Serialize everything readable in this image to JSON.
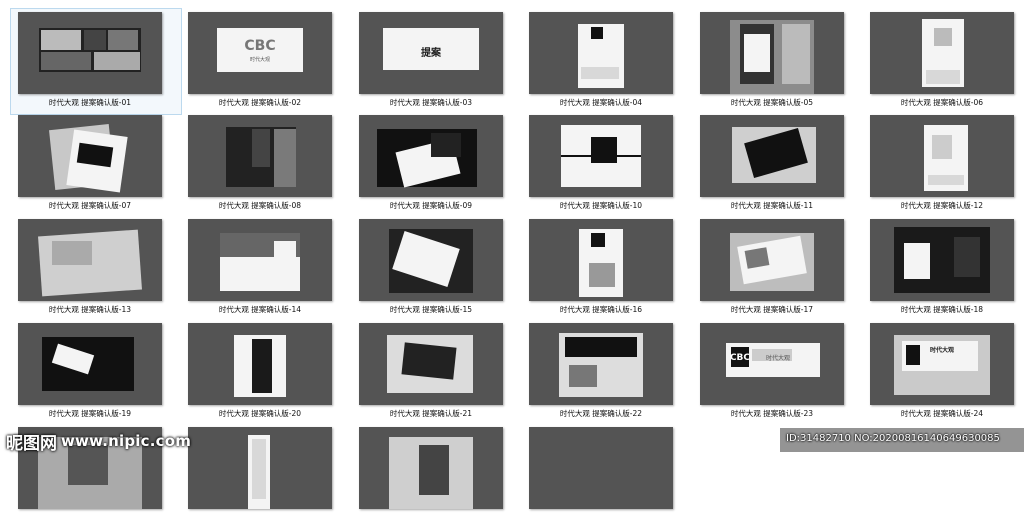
{
  "slides": [
    {
      "caption": "时代大观 提案确认版-01",
      "selected": true
    },
    {
      "caption": "时代大观 提案确认版-02",
      "logo": "CBC",
      "sub": "时代大观"
    },
    {
      "caption": "时代大观 提案确认版-03",
      "logo": "提案"
    },
    {
      "caption": "时代大观 提案确认版-04"
    },
    {
      "caption": "时代大观 提案确认版-05"
    },
    {
      "caption": "时代大观 提案确认版-06"
    },
    {
      "caption": "时代大观 提案确认版-07"
    },
    {
      "caption": "时代大观 提案确认版-08"
    },
    {
      "caption": "时代大观 提案确认版-09"
    },
    {
      "caption": "时代大观 提案确认版-10"
    },
    {
      "caption": "时代大观 提案确认版-11"
    },
    {
      "caption": "时代大观 提案确认版-12"
    },
    {
      "caption": "时代大观 提案确认版-13"
    },
    {
      "caption": "时代大观 提案确认版-14"
    },
    {
      "caption": "时代大观 提案确认版-15"
    },
    {
      "caption": "时代大观 提案确认版-16"
    },
    {
      "caption": "时代大观 提案确认版-17"
    },
    {
      "caption": "时代大观 提案确认版-18"
    },
    {
      "caption": "时代大观 提案确认版-19"
    },
    {
      "caption": "时代大观 提案确认版-20"
    },
    {
      "caption": "时代大观 提案确认版-21"
    },
    {
      "caption": "时代大观 提案确认版-22"
    },
    {
      "caption": "时代大观 提案确认版-23",
      "logo": "CBC",
      "sub": "时代大观"
    },
    {
      "caption": "时代大观 提案确认版-24",
      "logo": "时代大观"
    },
    {
      "caption": ""
    },
    {
      "caption": ""
    },
    {
      "caption": ""
    },
    {
      "caption": ""
    }
  ],
  "watermark": {
    "site": "昵图网",
    "url": "www.nipic.com",
    "id_text": "ID:31482710 NO:20200816140649630085"
  },
  "colors": {
    "slide_bg": "#545454",
    "selected_outline": "#bcd9ee"
  }
}
